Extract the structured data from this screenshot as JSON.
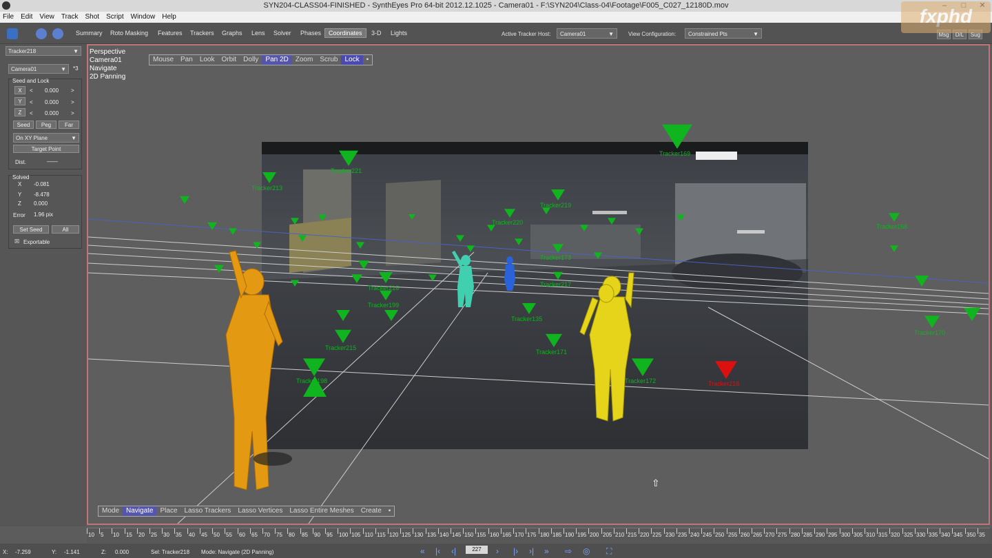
{
  "window": {
    "title": "SYN204-CLASS04-FINISHED - SynthEyes Pro 64-bit 2012.12.1025 - Camera01 - F:\\SYN204\\Class-04\\Footage\\F005_C027_12180D.mov",
    "min": "–",
    "max": "□",
    "close": "✕"
  },
  "menu": [
    "File",
    "Edit",
    "View",
    "Track",
    "Shot",
    "Script",
    "Window",
    "Help"
  ],
  "tabs": [
    "Summary",
    "Roto Masking",
    "Features",
    "Trackers",
    "Graphs",
    "Lens",
    "Solver",
    "Phases",
    "Coordinates",
    "3-D",
    "Lights"
  ],
  "active_tab": "Coordinates",
  "toolbar": {
    "tracker_host_label": "Active Tracker Host:",
    "tracker_host_value": "Camera01",
    "view_config_label": "View Configuration:",
    "view_config_value": "Constrained Pts",
    "right_buttons": [
      "Msg",
      "D/L",
      "Sug"
    ]
  },
  "logo_text": "fxphd",
  "left": {
    "tracker_select": "Tracker218",
    "camera_select": "Camera01",
    "camera_extra": "*3",
    "seed_title": "Seed and Lock",
    "axes": [
      {
        "axis": "X",
        "lt": "<",
        "value": "0.000",
        "gt": ">"
      },
      {
        "axis": "Y",
        "lt": "<",
        "value": "0.000",
        "gt": ">"
      },
      {
        "axis": "Z",
        "lt": "<",
        "value": "0.000",
        "gt": ">"
      }
    ],
    "seed_buttons": [
      "Seed",
      "Peg",
      "Far"
    ],
    "plane_select": "On XY Plane",
    "target_button": "Target Point",
    "dist_label": "Dist.",
    "dist_value": "——",
    "solved_title": "Solved",
    "solved": [
      {
        "k": "X",
        "v": "-0.081"
      },
      {
        "k": "Y",
        "v": "-8.478"
      },
      {
        "k": "Z",
        "v": "0.000"
      }
    ],
    "error_label": "Error",
    "error_value": "1.96 pix",
    "set_seed": "Set Seed",
    "all": "All",
    "exportable_check": "☒",
    "exportable": "Exportable"
  },
  "viewport": {
    "info": [
      "Perspective",
      "Camera01",
      "Navigate",
      "2D Panning"
    ],
    "nav_modes": [
      "Mouse",
      "Pan",
      "Look",
      "Orbit",
      "Dolly",
      "Pan 2D",
      "Zoom",
      "Scrub",
      "Lock"
    ],
    "nav_active": "Pan 2D",
    "nav_lock": "Lock",
    "edit_modes": [
      "Mode",
      "Navigate",
      "Place",
      "Lasso Trackers",
      "Lasso Vertices",
      "Lasso Entire Meshes",
      "Create"
    ],
    "edit_active": "Navigate"
  },
  "trackers": [
    {
      "label": "Tracker169"
    },
    {
      "label": "Tracker221"
    },
    {
      "label": "Tracker213"
    },
    {
      "label": "Tracker219"
    },
    {
      "label": "Tracker220"
    },
    {
      "label": "Tracker168"
    },
    {
      "label": "Tracker173"
    },
    {
      "label": "Tracker216"
    },
    {
      "label": "Tracker199"
    },
    {
      "label": "Tracker217"
    },
    {
      "label": "Tracker135"
    },
    {
      "label": "Tracker171"
    },
    {
      "label": "Tracker215"
    },
    {
      "label": "Tracker198"
    },
    {
      "label": "Tracker170"
    },
    {
      "label": "Tracker172"
    },
    {
      "label": "Tracker218"
    }
  ],
  "timeline": {
    "labels": [
      "10",
      "5",
      "10",
      "15",
      "20",
      "25",
      "30",
      "35",
      "40",
      "45",
      "50",
      "55",
      "60",
      "65",
      "70",
      "75",
      "80",
      "85",
      "90",
      "95",
      "100",
      "105",
      "110",
      "115",
      "120",
      "125",
      "130",
      "135",
      "140",
      "145",
      "150",
      "155",
      "160",
      "165",
      "170",
      "175",
      "180",
      "185",
      "190",
      "195",
      "200",
      "205",
      "210",
      "215",
      "220",
      "225",
      "230",
      "235",
      "240",
      "245",
      "250",
      "255",
      "260",
      "265",
      "270",
      "275",
      "280",
      "285",
      "290",
      "295",
      "300",
      "305",
      "310",
      "315",
      "320",
      "325",
      "330",
      "335",
      "340",
      "345",
      "350",
      "35"
    ]
  },
  "status": {
    "x_label": "X:",
    "x": "-7.259",
    "y_label": "Y:",
    "y": "-1.141",
    "z_label": "Z:",
    "z": "0.000",
    "sel": "Sel: Tracker218",
    "mode": "Mode: Navigate (2D Panning)",
    "frame": "227"
  },
  "colors": {
    "tracker": "#0fb41f",
    "selected_tracker": "#dd1010",
    "figure_orange": "#e39a12",
    "figure_yellow": "#e6d41a",
    "figure_teal": "#40d0b0",
    "figure_blue": "#2a62d8",
    "viewport_border": "#c07676",
    "active_mode": "#5555aa"
  }
}
